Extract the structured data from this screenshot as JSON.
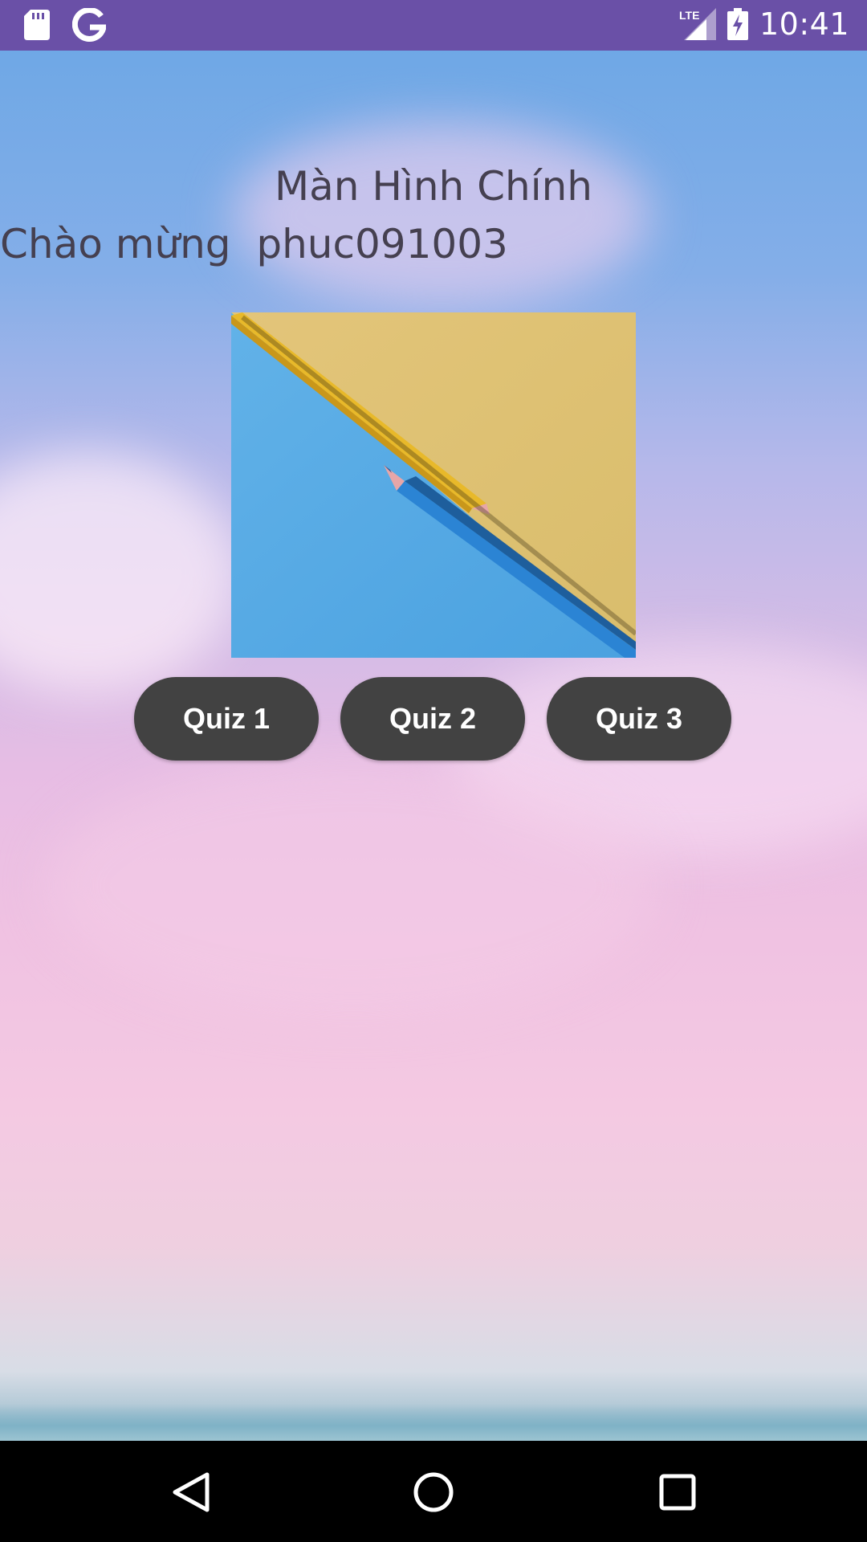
{
  "status_bar": {
    "time": "10:41",
    "network": "LTE",
    "color": "#6a50a7",
    "icons": [
      "sd-card-icon",
      "google-icon",
      "signal-icon",
      "battery-charging-icon"
    ]
  },
  "screen": {
    "title": "Màn Hình Chính",
    "welcome": "Chào mừng  phuc091003"
  },
  "buttons": {
    "quiz1": "Quiz 1",
    "quiz2": "Quiz 2",
    "quiz3": "Quiz 3",
    "color": "#424242"
  },
  "nav_bar": {
    "icons": [
      "back-icon",
      "home-icon",
      "recents-icon"
    ]
  }
}
